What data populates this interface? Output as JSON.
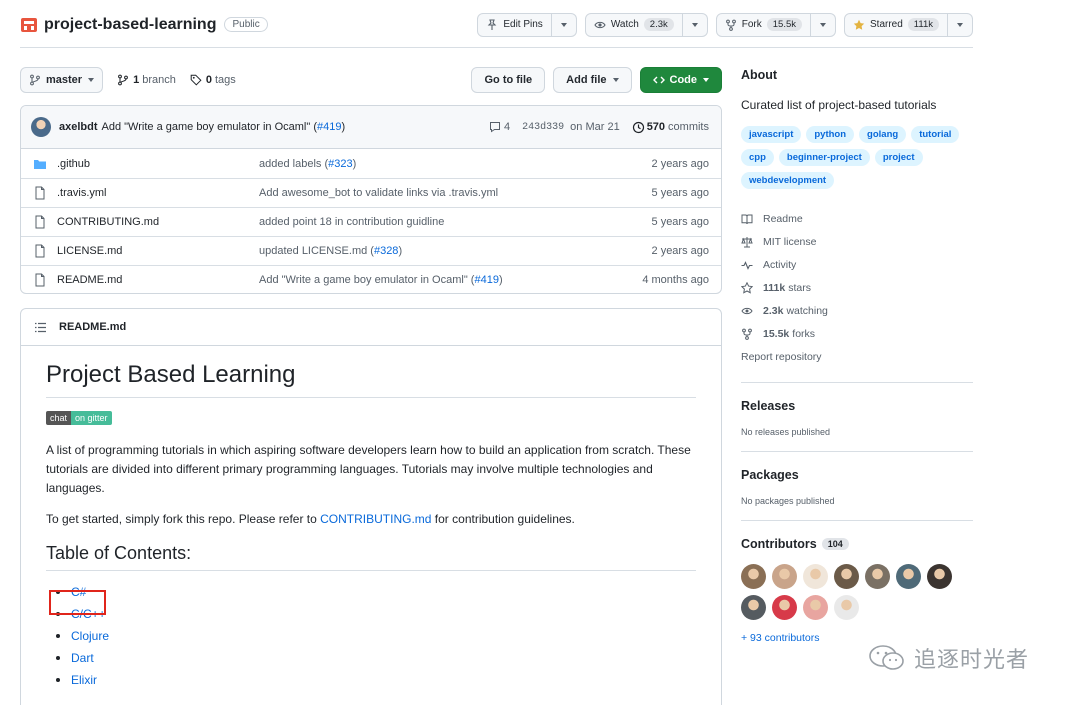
{
  "header": {
    "repo_name": "project-based-learning",
    "visibility": "Public",
    "edit_pins": "Edit Pins",
    "watch_label": "Watch",
    "watch_count": "2.3k",
    "fork_label": "Fork",
    "fork_count": "15.5k",
    "star_label": "Starred",
    "star_count": "111k"
  },
  "toolbar": {
    "branch": "master",
    "branch_count": "1",
    "branch_word": "branch",
    "tag_count": "0",
    "tag_word": "tags",
    "go_to_file": "Go to file",
    "add_file": "Add file",
    "code": "Code"
  },
  "commit": {
    "author": "axelbdt",
    "message_prefix": "Add \"Write a game boy emulator in Ocaml\" (",
    "pr_link": "#419",
    "message_suffix": ")",
    "comments": "4",
    "sha": "243d339",
    "date": "on Mar 21",
    "commit_count": "570",
    "commit_word": "commits"
  },
  "files": [
    {
      "name": ".github",
      "type": "folder",
      "msg_prefix": "added labels (",
      "msg_link": "#323",
      "msg_suffix": ")",
      "age": "2 years ago"
    },
    {
      "name": ".travis.yml",
      "type": "file",
      "msg_prefix": "Add awesome_bot to validate links via .travis.yml",
      "msg_link": "",
      "msg_suffix": "",
      "age": "5 years ago"
    },
    {
      "name": "CONTRIBUTING.md",
      "type": "file",
      "msg_prefix": "added point 18 in contribution guidline",
      "msg_link": "",
      "msg_suffix": "",
      "age": "5 years ago"
    },
    {
      "name": "LICENSE.md",
      "type": "file",
      "msg_prefix": "updated LICENSE.md (",
      "msg_link": "#328",
      "msg_suffix": ")",
      "age": "2 years ago"
    },
    {
      "name": "README.md",
      "type": "file",
      "msg_prefix": "Add \"Write a game boy emulator in Ocaml\" (",
      "msg_link": "#419",
      "msg_suffix": ")",
      "age": "4 months ago"
    }
  ],
  "readme": {
    "filename": "README.md",
    "title": "Project Based Learning",
    "badge_left": "chat",
    "badge_right": "on gitter",
    "intro": "A list of programming tutorials in which aspiring software developers learn how to build an application from scratch. These tutorials are divided into different primary programming languages. Tutorials may involve multiple technologies and languages.",
    "start_prefix": "To get started, simply fork this repo. Please refer to ",
    "start_link": "CONTRIBUTING.md",
    "start_suffix": " for contribution guidelines.",
    "toc_title": "Table of Contents:",
    "toc": [
      "C#",
      "C/C++",
      "Clojure",
      "Dart",
      "Elixir"
    ]
  },
  "about": {
    "heading": "About",
    "description": "Curated list of project-based tutorials",
    "topics": [
      "javascript",
      "python",
      "golang",
      "tutorial",
      "cpp",
      "beginner-project",
      "project",
      "webdevelopment"
    ],
    "readme": "Readme",
    "license": "MIT license",
    "activity": "Activity",
    "stars_count": "111k",
    "stars_word": "stars",
    "watching_count": "2.3k",
    "watching_word": "watching",
    "forks_count": "15.5k",
    "forks_word": "forks",
    "report": "Report repository"
  },
  "releases": {
    "heading": "Releases",
    "empty": "No releases published"
  },
  "packages": {
    "heading": "Packages",
    "empty": "No packages published"
  },
  "contributors": {
    "heading": "Contributors",
    "count": "104",
    "more": "+ 93 contributors",
    "avatar_colors": [
      "#8a6f55",
      "#c9a48a",
      "#f0e6da",
      "#6b5a48",
      "#7a7064",
      "#4f6a78",
      "#3b3430",
      "#555b60",
      "#d73a49",
      "#e8a5a0",
      "#e9e9e9"
    ]
  },
  "watermark": {
    "text": "追逐时光者"
  },
  "colors": {
    "accent": "#0969da",
    "green": "#1f883d",
    "highlight": "#e0251b"
  }
}
